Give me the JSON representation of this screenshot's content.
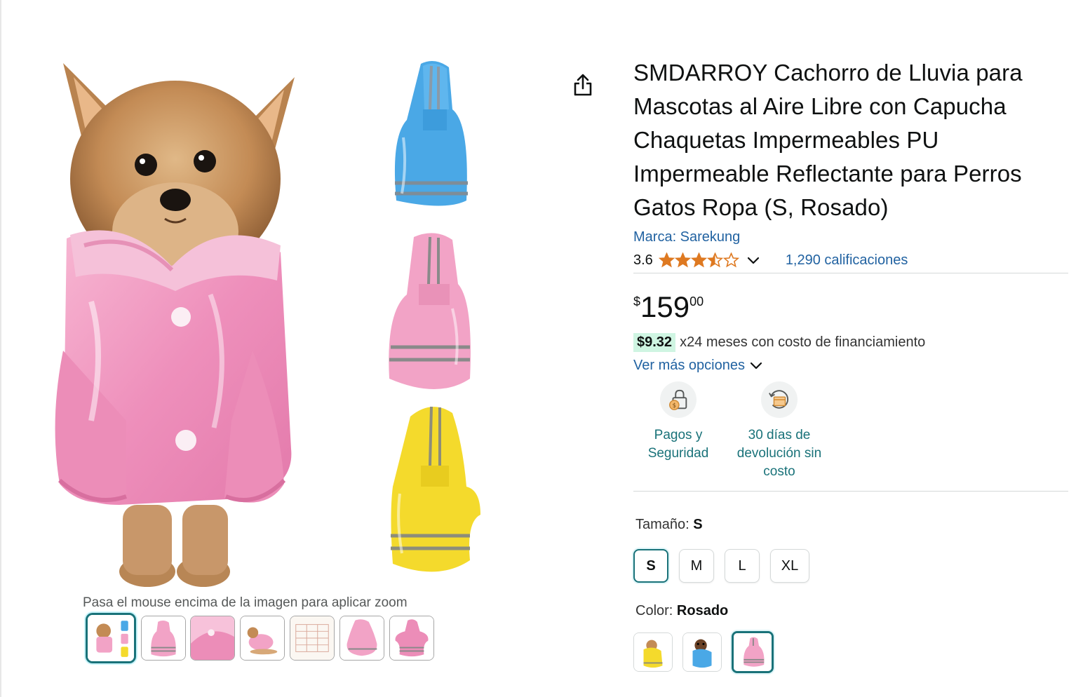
{
  "product": {
    "title": "SMDARROY Cachorro de Lluvia para Mascotas al Aire Libre con Capucha Chaquetas Impermeables PU Impermeable Reflectante para Perros Gatos Ropa (S, Rosado)",
    "brand": "Marca: Sarekung",
    "rating": "3.6",
    "rating_stars": 3.6,
    "ratings_count": "1,290 calificaciones"
  },
  "price": {
    "symbol": "$",
    "whole": "159",
    "fraction": "00"
  },
  "financing": {
    "amount": "$9.32",
    "text": "x24 meses con costo de financiamiento",
    "more_options": "Ver más opciones"
  },
  "badges": [
    {
      "line1": "Pagos y",
      "line2": "Seguridad",
      "icon": "lock-icon"
    },
    {
      "line1": "30 días de",
      "line2": "devolución sin",
      "line3": "costo",
      "icon": "return-box-icon"
    }
  ],
  "size": {
    "label": "Tamaño: ",
    "selected": "S",
    "options": [
      "S",
      "M",
      "L",
      "XL"
    ]
  },
  "color": {
    "label": "Color: ",
    "selected": "Rosado"
  },
  "gallery": {
    "zoom_hint": "Pasa el mouse encima de la imagen para aplicar zoom"
  },
  "colors": {
    "accent_teal": "#197279",
    "link_blue": "#2162a1",
    "star_orange": "#de7921",
    "fin_highlight": "#cff5e2",
    "coat_pink": "#f2a3c6",
    "coat_blue": "#4aa8e6",
    "coat_yellow": "#f4da2c"
  }
}
